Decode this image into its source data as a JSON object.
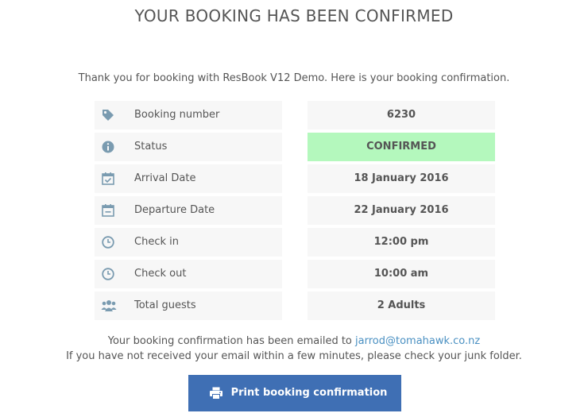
{
  "header": {
    "title": "YOUR BOOKING HAS BEEN CONFIRMED",
    "intro": "Thank you for booking with ResBook V12 Demo. Here is your booking confirmation."
  },
  "details": [
    {
      "icon": "tag-icon",
      "label": "Booking number",
      "value": "6230"
    },
    {
      "icon": "info-icon",
      "label": "Status",
      "value": "CONFIRMED"
    },
    {
      "icon": "calendar-check-icon",
      "label": "Arrival Date",
      "value": "18 January 2016"
    },
    {
      "icon": "calendar-minus-icon",
      "label": "Departure Date",
      "value": "22 January 2016"
    },
    {
      "icon": "clock-icon",
      "label": "Check in",
      "value": "12:00 pm"
    },
    {
      "icon": "clock-icon",
      "label": "Check out",
      "value": "10:00 am"
    },
    {
      "icon": "users-icon",
      "label": "Total guests",
      "value": "2 Adults"
    }
  ],
  "footer": {
    "email_prefix": "Your booking confirmation has been emailed to ",
    "email": "jarrod@tomahawk.co.nz",
    "junk_notice": "If you have not received your email within a few minutes, please check your junk folder.",
    "print_label": "Print booking confirmation",
    "print_icon": "printer-icon"
  },
  "colors": {
    "icon": "#7a9bb0",
    "confirmed_bg": "#b4f8bd",
    "row_bg": "#f7f7f7",
    "button_bg": "#3f6fb4",
    "link": "#4a90c2"
  }
}
